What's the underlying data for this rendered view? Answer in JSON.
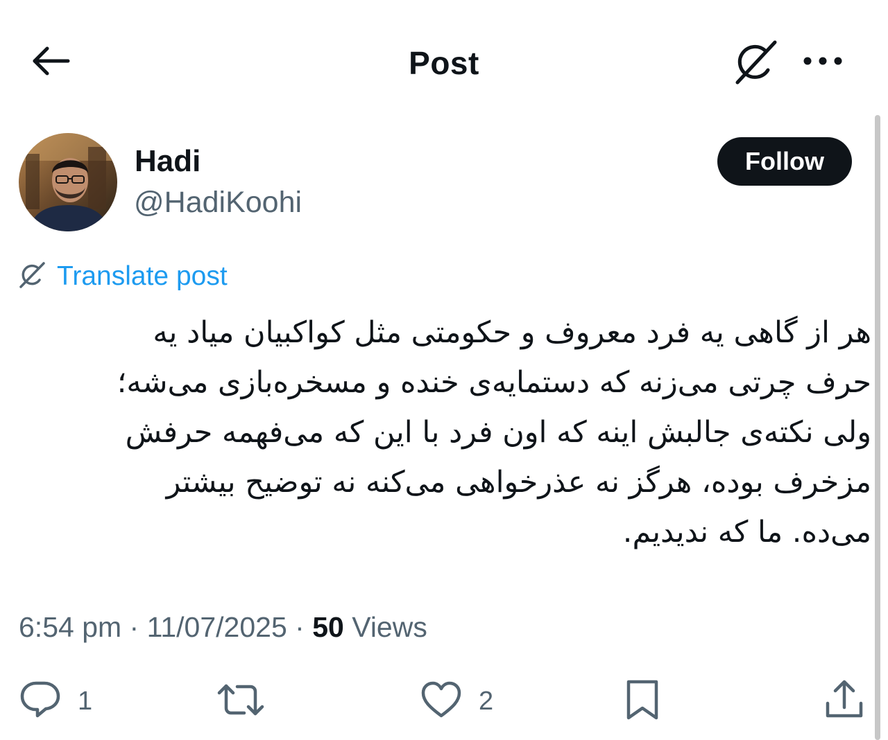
{
  "header": {
    "title": "Post",
    "back_icon": "arrow-left-icon",
    "grok_icon": "grok-icon",
    "more_icon": "more-horizontal-icon"
  },
  "author": {
    "display_name": "Hadi",
    "handle": "@HadiKoohi",
    "follow_label": "Follow"
  },
  "translate": {
    "label": "Translate post",
    "icon": "grok-icon"
  },
  "post": {
    "lines": [
      "هر از گاهی یه فرد معروف و حکومتی مثل کواکبیان میاد یه",
      "حرف چرتی می‌زنه که دستمایه‌ی خنده و مسخره‌بازی می‌شه؛",
      "ولی نکته‌ی جالبش اینه که اون فرد با این که می‌فهمه حرفش",
      "مزخرف بوده، هرگز نه عذرخواهی می‌کنه نه توضیح بیشتر",
      "می‌ده. ما که ندیدیم."
    ]
  },
  "meta": {
    "time": "6:54 pm",
    "date": "11/07/2025",
    "views_count": "50",
    "views_label": "Views",
    "separator": " · "
  },
  "actions": {
    "reply_count": "1",
    "repost_count": "",
    "like_count": "2",
    "reply_icon": "reply-icon",
    "repost_icon": "repost-icon",
    "like_icon": "heart-icon",
    "bookmark_icon": "bookmark-icon",
    "share_icon": "share-icon"
  },
  "colors": {
    "text": "#0f1419",
    "secondary": "#536471",
    "link": "#1d9bf0",
    "button_bg": "#0f1419",
    "button_text": "#ffffff"
  }
}
